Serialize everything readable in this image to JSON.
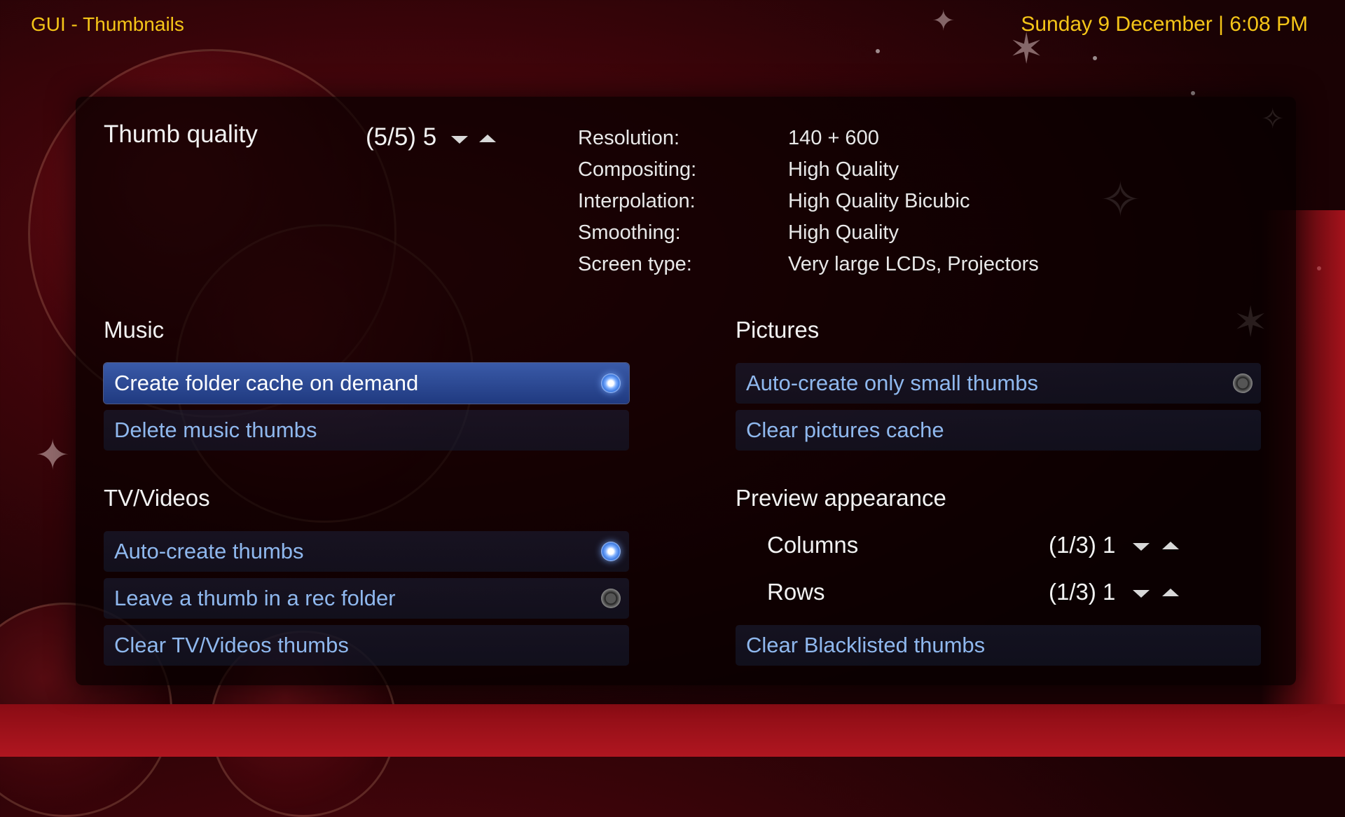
{
  "header": {
    "title": "GUI - Thumbnails",
    "datetime": "Sunday 9 December | 6:08 PM"
  },
  "thumb_quality": {
    "label": "Thumb quality",
    "value": "(5/5) 5",
    "info": [
      {
        "key": "Resolution:",
        "value": "140 + 600"
      },
      {
        "key": "Compositing:",
        "value": "High Quality"
      },
      {
        "key": "Interpolation:",
        "value": "High Quality Bicubic"
      },
      {
        "key": "Smoothing:",
        "value": "High Quality"
      },
      {
        "key": "Screen type:",
        "value": "Very large LCDs, Projectors"
      }
    ]
  },
  "music": {
    "heading": "Music",
    "items": [
      {
        "label": "Create folder cache on demand",
        "selected": true,
        "radio": "on"
      },
      {
        "label": "Delete music thumbs"
      }
    ]
  },
  "tv_videos": {
    "heading": "TV/Videos",
    "items": [
      {
        "label": "Auto-create thumbs",
        "radio": "on"
      },
      {
        "label": "Leave a thumb in a rec folder",
        "radio": "off"
      },
      {
        "label": "Clear TV/Videos thumbs"
      }
    ]
  },
  "pictures": {
    "heading": "Pictures",
    "items": [
      {
        "label": "Auto-create only small thumbs",
        "radio": "off"
      },
      {
        "label": "Clear pictures cache"
      }
    ]
  },
  "preview": {
    "heading": "Preview appearance",
    "columns": {
      "label": "Columns",
      "value": "(1/3) 1"
    },
    "rows": {
      "label": "Rows",
      "value": "(1/3) 1"
    },
    "clear_label": "Clear Blacklisted thumbs"
  },
  "colors": {
    "accent_yellow": "#f5c518",
    "item_text": "#8fb8ee",
    "selected_row": "#2f4d99"
  }
}
